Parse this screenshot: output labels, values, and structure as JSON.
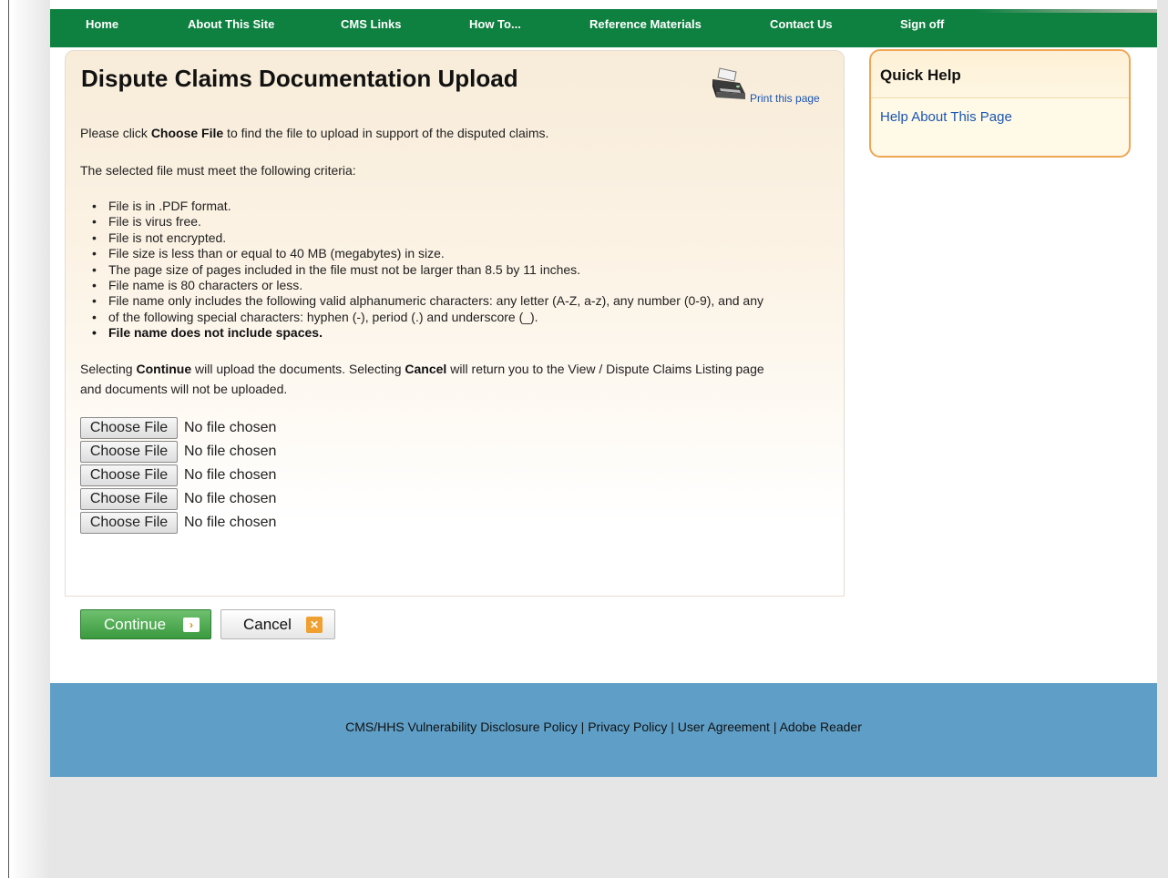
{
  "nav": {
    "items": [
      "Home",
      "About This Site",
      "CMS Links",
      "How To...",
      "Reference Materials",
      "Contact Us",
      "Sign off"
    ]
  },
  "main": {
    "title": "Dispute Claims Documentation Upload",
    "print_link": "Print this page",
    "intro": {
      "pre": "Please click ",
      "bold": "Choose File",
      "post": " to find the file to upload in support of the disputed claims."
    },
    "criteria_intro": "The selected file must meet the following criteria:",
    "criteria": [
      "File is in .PDF format.",
      "File is virus free.",
      "File is not encrypted.",
      "File size is less than or equal to 40 MB (megabytes) in size.",
      "The page size of pages included in the file must not be larger than 8.5 by 11 inches.",
      "File name is 80 characters or less.",
      "File name only includes the following valid alphanumeric characters: any letter (A-Z, a-z), any number (0-9), and any",
      "of the following special characters: hyphen (-), period (.) and underscore (_).",
      "File name does not include spaces."
    ],
    "selecting": {
      "a": "Selecting ",
      "continue_bold": "Continue",
      "b": " will upload the documents. Selecting ",
      "cancel_bold": "Cancel",
      "c": " will return you to the View / Dispute Claims Listing page",
      "line2": "and documents will not be uploaded."
    },
    "file_inputs": [
      {
        "button": "Choose File",
        "status": "No file chosen"
      },
      {
        "button": "Choose File",
        "status": "No file chosen"
      },
      {
        "button": "Choose File",
        "status": "No file chosen"
      },
      {
        "button": "Choose File",
        "status": "No file chosen"
      },
      {
        "button": "Choose File",
        "status": "No file chosen"
      }
    ],
    "continue_label": "Continue",
    "cancel_label": "Cancel"
  },
  "quick_help": {
    "title": "Quick Help",
    "link": "Help About This Page"
  },
  "footer": {
    "links": [
      "CMS/HHS Vulnerability Disclosure Policy",
      "Privacy Policy",
      "User Agreement",
      "Adobe Reader"
    ],
    "separator": " | "
  },
  "colors": {
    "nav_bg": "#0e8040",
    "footer_bg": "#5f9fc7",
    "link": "#1a55b3",
    "help_border": "#f0a654",
    "continue_bg": "#3a9a3f",
    "cancel_icon": "#f0a030"
  },
  "icons": {
    "printer": "printer-icon",
    "continue": "chevron-right-icon",
    "cancel": "close-icon"
  }
}
